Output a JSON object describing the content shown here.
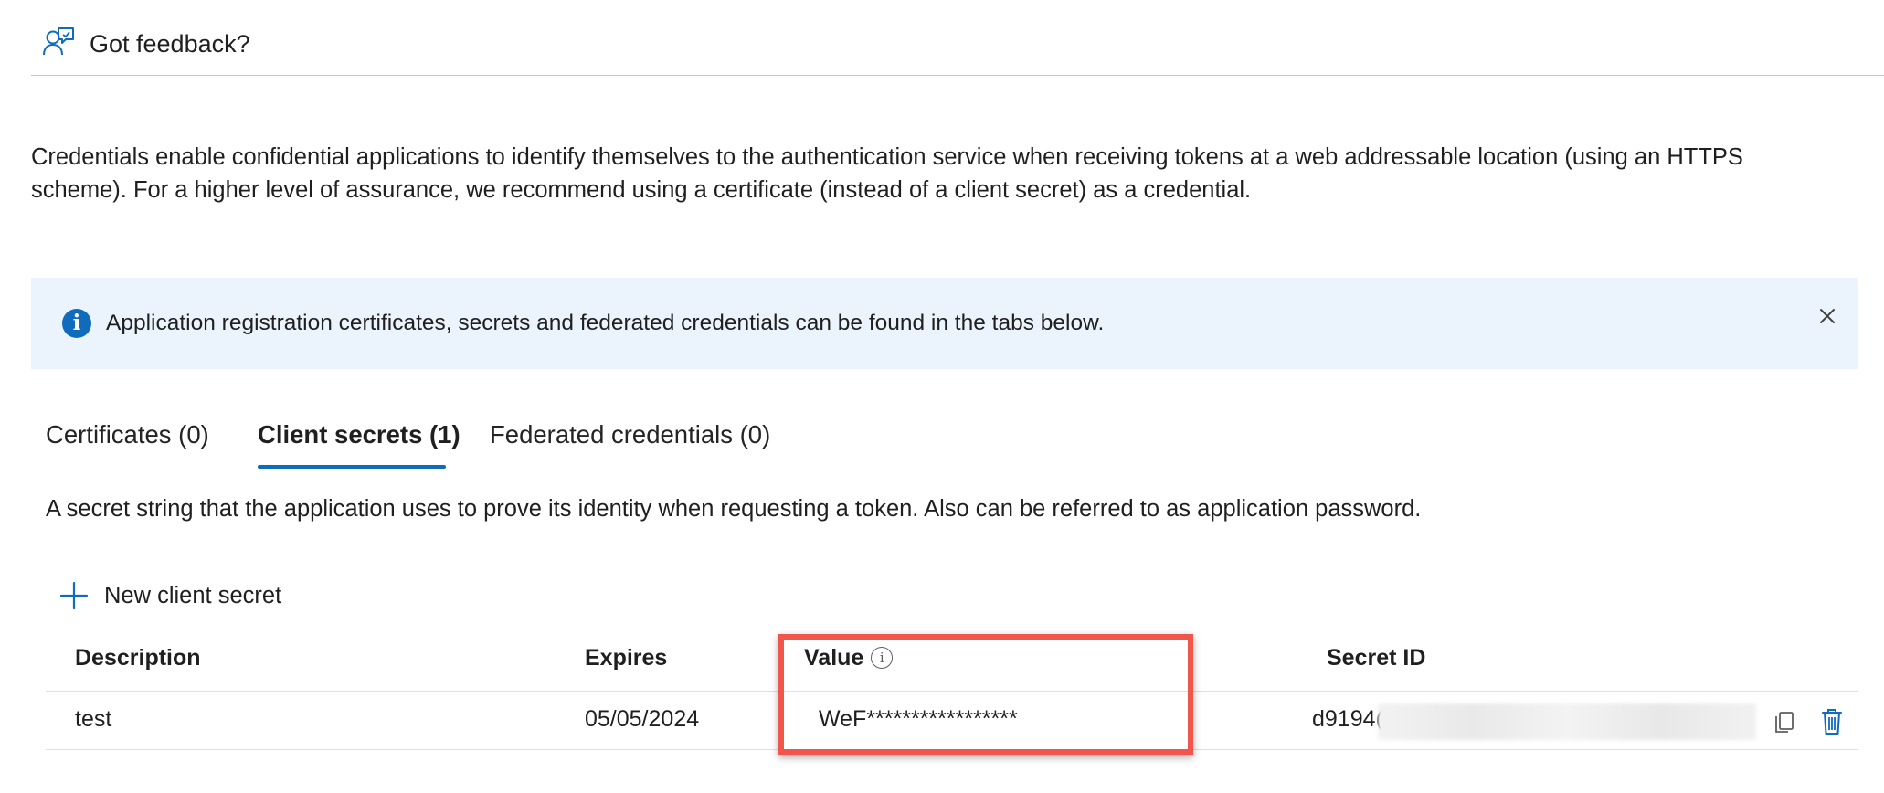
{
  "feedback": {
    "label": "Got feedback?",
    "icon": "feedback-person-icon"
  },
  "intro_text": "Credentials enable confidential applications to identify themselves to the authentication service when receiving tokens at a web addressable location (using an HTTPS scheme). For a higher level of assurance, we recommend using a certificate (instead of a client secret) as a credential.",
  "banner": {
    "icon": "info-icon",
    "info_glyph": "i",
    "message": "Application registration certificates, secrets and federated credentials can be found in the tabs below.",
    "close_icon": "close-icon"
  },
  "tabs": [
    {
      "label": "Certificates (0)",
      "selected": false
    },
    {
      "label": "Client secrets (1)",
      "selected": true
    },
    {
      "label": "Federated credentials (0)",
      "selected": false
    }
  ],
  "tab_help": "A secret string that the application uses to prove its identity when requesting a token. Also can be referred to as application password.",
  "new_secret": {
    "label": "New client secret",
    "icon": "plus-icon"
  },
  "table": {
    "headers": {
      "description": "Description",
      "expires": "Expires",
      "value": "Value",
      "value_info_glyph": "i",
      "secret_id": "Secret ID"
    },
    "rows": [
      {
        "description": "test",
        "expires": "05/05/2024",
        "value": "WeF*****************",
        "secret_id": "d9194("
      }
    ]
  },
  "colors": {
    "accent": "#0f6cbd",
    "banner_bg": "#ebf3fc",
    "highlight": "#f0564b",
    "delete": "#0f6cbd"
  }
}
